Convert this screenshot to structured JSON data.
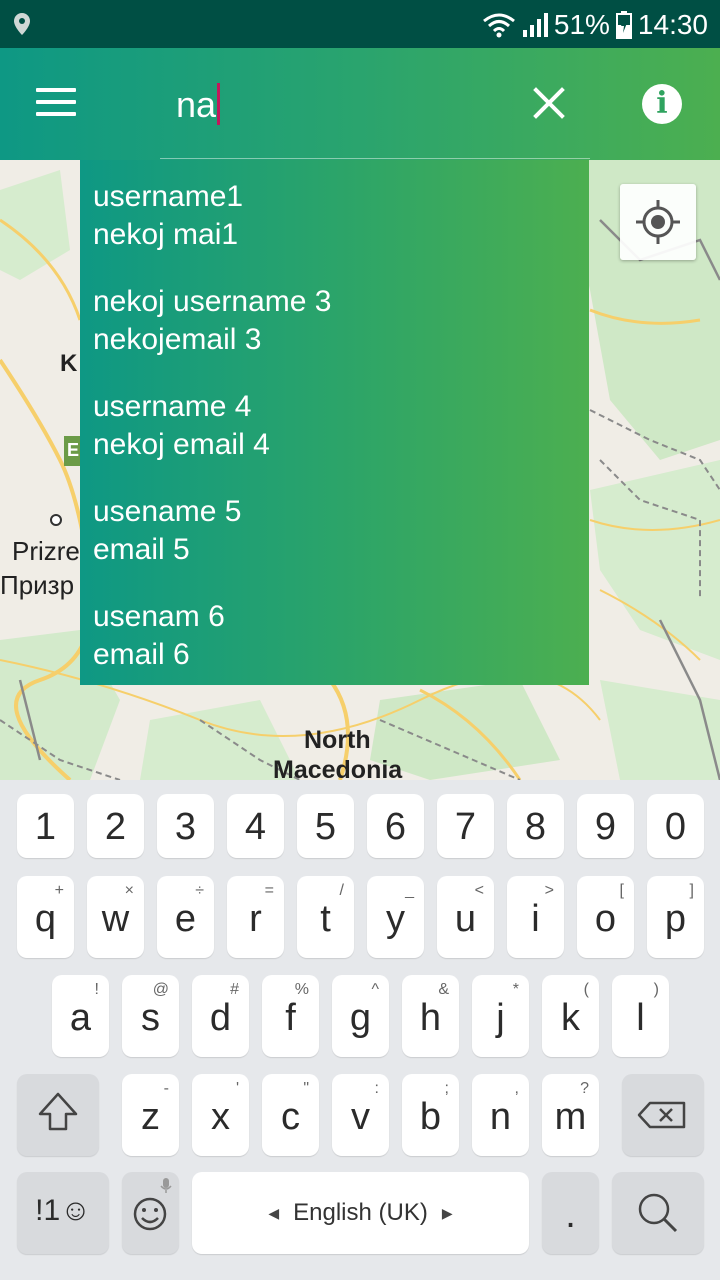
{
  "status_bar": {
    "battery": "51%",
    "time": "14:30",
    "icons": [
      "location-icon",
      "wifi-icon",
      "signal-icon",
      "battery-charging-icon"
    ]
  },
  "toolbar": {
    "search_value": "na",
    "icons": [
      "menu-icon",
      "close-icon",
      "info-icon"
    ]
  },
  "suggestions": [
    {
      "username": "username1",
      "email": "nekoj mai1"
    },
    {
      "username": "nekoj username 3",
      "email": "nekojemail 3"
    },
    {
      "username": "username 4",
      "email": "nekoj email 4"
    },
    {
      "username": "usename 5",
      "email": "email 5"
    },
    {
      "username": "usenam 6",
      "email": "email 6"
    }
  ],
  "map": {
    "labels": {
      "k": "K",
      "prizren": "Prizre",
      "prizren_cyrillic": "Призр",
      "north": "North",
      "macedonia": "Macedonia",
      "e_badge": "E"
    },
    "colors": {
      "green_area": "#cfe8c6",
      "road": "#f6cf6b",
      "border": "#8a8a8a"
    }
  },
  "keyboard": {
    "number_row": [
      "1",
      "2",
      "3",
      "4",
      "5",
      "6",
      "7",
      "8",
      "9",
      "0"
    ],
    "row1": [
      {
        "key": "q",
        "alt": "+"
      },
      {
        "key": "w",
        "alt": "×"
      },
      {
        "key": "e",
        "alt": "÷"
      },
      {
        "key": "r",
        "alt": "="
      },
      {
        "key": "t",
        "alt": "/"
      },
      {
        "key": "y",
        "alt": "_"
      },
      {
        "key": "u",
        "alt": "<"
      },
      {
        "key": "i",
        "alt": ">"
      },
      {
        "key": "o",
        "alt": "["
      },
      {
        "key": "p",
        "alt": "]"
      }
    ],
    "row2": [
      {
        "key": "a",
        "alt": "!"
      },
      {
        "key": "s",
        "alt": "@"
      },
      {
        "key": "d",
        "alt": "#"
      },
      {
        "key": "f",
        "alt": "%"
      },
      {
        "key": "g",
        "alt": "^"
      },
      {
        "key": "h",
        "alt": "&"
      },
      {
        "key": "j",
        "alt": "*"
      },
      {
        "key": "k",
        "alt": "("
      },
      {
        "key": "l",
        "alt": ")"
      }
    ],
    "row3": [
      {
        "key": "z",
        "alt": "-"
      },
      {
        "key": "x",
        "alt": "'"
      },
      {
        "key": "c",
        "alt": "\""
      },
      {
        "key": "v",
        "alt": ":"
      },
      {
        "key": "b",
        "alt": ";"
      },
      {
        "key": "n",
        "alt": ","
      },
      {
        "key": "m",
        "alt": "?"
      }
    ],
    "symbols_label": "!1☺",
    "space_label": "English (UK)",
    "period": ".",
    "icons": [
      "shift-icon",
      "backspace-icon",
      "emoji-icon",
      "search-icon"
    ]
  }
}
